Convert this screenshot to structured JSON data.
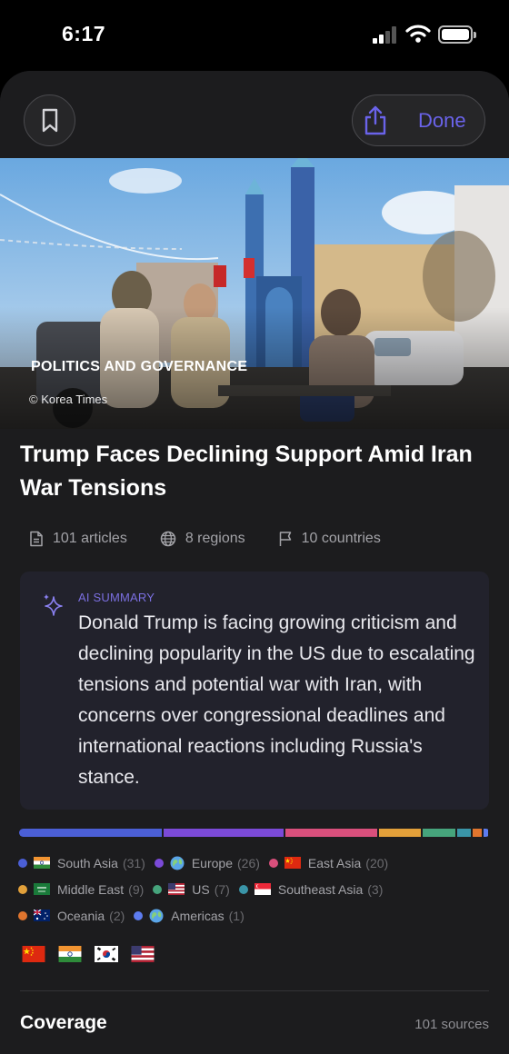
{
  "status": {
    "time": "6:17"
  },
  "toolbar": {
    "done_label": "Done"
  },
  "hero": {
    "category": "POLITICS AND GOVERNANCE",
    "credit": "© Korea Times"
  },
  "article": {
    "title": "Trump Faces Declining Support Amid Iran War Tensions",
    "stats": {
      "articles": "101 articles",
      "regions": "8 regions",
      "countries": "10 countries"
    }
  },
  "summary": {
    "label": "AI SUMMARY",
    "text": "Donald Trump is facing growing criticism and declining popularity in the US due to escalating tensions and potential war with Iran, with concerns over congressional deadlines and international reactions including Russia's stance."
  },
  "regions": [
    {
      "name": "South Asia",
      "count": "(31)",
      "color": "#4b5fd6",
      "icon": "india-flag"
    },
    {
      "name": "Europe",
      "count": "(26)",
      "color": "#7b4ad8",
      "icon": "globe-icon"
    },
    {
      "name": "East Asia",
      "count": "(20)",
      "color": "#d94f7c",
      "icon": "china-flag"
    },
    {
      "name": "Middle East",
      "count": "(9)",
      "color": "#e2a03a",
      "icon": "saudi-flag"
    },
    {
      "name": "US",
      "count": "(7)",
      "color": "#46a47c",
      "icon": "us-flag"
    },
    {
      "name": "Southeast Asia",
      "count": "(3)",
      "color": "#3a95a8",
      "icon": "singapore-flag"
    },
    {
      "name": "Oceania",
      "count": "(2)",
      "color": "#e0752e",
      "icon": "australia-flag"
    },
    {
      "name": "Americas",
      "count": "(1)",
      "color": "#5d7cf0",
      "icon": "globe-icon"
    }
  ],
  "distribution_values": [
    31,
    26,
    20,
    9,
    7,
    3,
    2,
    1
  ],
  "country_flags": [
    "china-flag",
    "india-flag",
    "south-korea-flag",
    "us-flag"
  ],
  "coverage": {
    "title": "Coverage",
    "sources": "101 sources"
  }
}
